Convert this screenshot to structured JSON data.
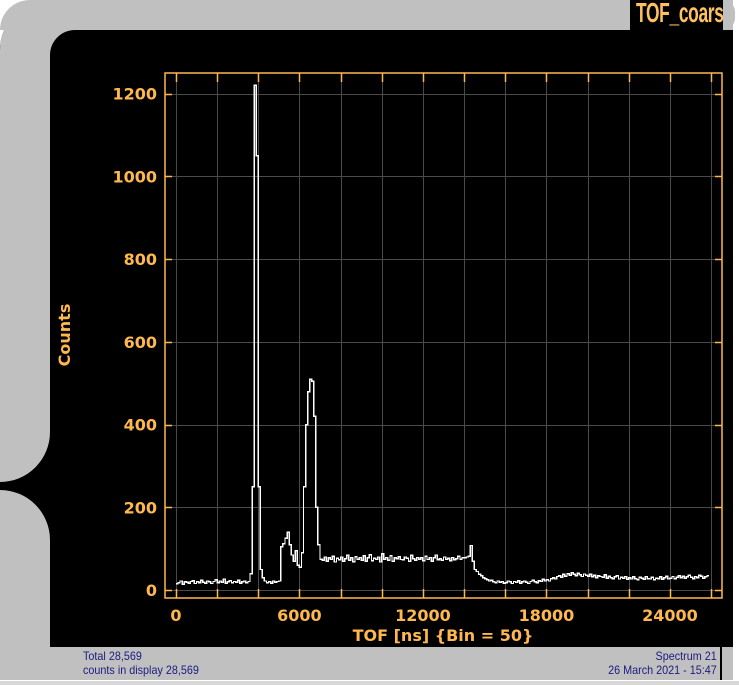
{
  "window": {
    "title": "TOF_coarse"
  },
  "footer": {
    "total": "Total 28,569",
    "counts_in_display": "counts in display 28,569",
    "spectrum": "Spectrum 21",
    "datetime": "26 March 2021 - 15:47"
  },
  "colors": {
    "axis": "#ffb84d",
    "grid": "#4a4a4a",
    "trace": "#ffffff",
    "background": "#000000",
    "footer_text": "#1c1c80"
  },
  "chart_data": {
    "type": "line",
    "title": "TOF_coarse",
    "xlabel": "TOF [ns] {Bin = 50}",
    "ylabel": "Counts",
    "xlim": [
      -530,
      26530
    ],
    "ylim": [
      -19,
      1250
    ],
    "xticks": [
      0,
      6000,
      12000,
      18000,
      24000
    ],
    "xtick_labels": [
      "0",
      "6000",
      "12000",
      "18000",
      "24000"
    ],
    "xgrid_step": 2000,
    "yticks": [
      0,
      200,
      400,
      600,
      800,
      1000,
      1200
    ],
    "ytick_labels": [
      "0",
      "200",
      "400",
      "600",
      "800",
      "1000",
      "1200"
    ],
    "grid": true,
    "series": [
      {
        "name": "Spectrum 21",
        "x_start": 0,
        "x_step": 100,
        "values": [
          15,
          18,
          22,
          14,
          20,
          19,
          17,
          21,
          23,
          16,
          20,
          18,
          24,
          19,
          17,
          22,
          20,
          16,
          21,
          25,
          18,
          22,
          19,
          27,
          17,
          20,
          23,
          18,
          21,
          19,
          24,
          17,
          20,
          22,
          18,
          21,
          40,
          250,
          1220,
          1050,
          250,
          50,
          30,
          22,
          18,
          20,
          17,
          22,
          19,
          21,
          22,
          105,
          112,
          125,
          140,
          110,
          85,
          70,
          95,
          60,
          55,
          90,
          250,
          400,
          480,
          510,
          505,
          420,
          200,
          110,
          75,
          72,
          80,
          70,
          78,
          74,
          82,
          68,
          77,
          73,
          80,
          70,
          76,
          84,
          72,
          78,
          69,
          81,
          75,
          79,
          72,
          83,
          70,
          78,
          86,
          71,
          77,
          74,
          80,
          68,
          88,
          75,
          79,
          72,
          83,
          70,
          78,
          76,
          81,
          74,
          73,
          80,
          77,
          70,
          84,
          76,
          72,
          79,
          75,
          78,
          71,
          82,
          74,
          79,
          70,
          78,
          85,
          73,
          76,
          72,
          80,
          74,
          77,
          71,
          79,
          73,
          76,
          82,
          75,
          78,
          78,
          80,
          82,
          108,
          70,
          50,
          45,
          38,
          35,
          30,
          28,
          25,
          22,
          24,
          20,
          18,
          22,
          19,
          21,
          17,
          18,
          22,
          20,
          16,
          21,
          19,
          23,
          17,
          20,
          22,
          19,
          16,
          21,
          24,
          20,
          18,
          23,
          21,
          26,
          22,
          25,
          22,
          28,
          30,
          27,
          33,
          35,
          31,
          38,
          34,
          40,
          36,
          42,
          38,
          35,
          41,
          37,
          33,
          39,
          36,
          34,
          38,
          32,
          36,
          30,
          35,
          33,
          31,
          37,
          29,
          34,
          30,
          28,
          32,
          35,
          27,
          31,
          29,
          33,
          26,
          30,
          27,
          32,
          28,
          25,
          31,
          29,
          26,
          33,
          28,
          27,
          31,
          25,
          29,
          28,
          32,
          26,
          30,
          34,
          27,
          29,
          33,
          28,
          31,
          35,
          30,
          34,
          29,
          32,
          36,
          31,
          28,
          33,
          30,
          36,
          34,
          29,
          32,
          35
        ]
      }
    ]
  }
}
